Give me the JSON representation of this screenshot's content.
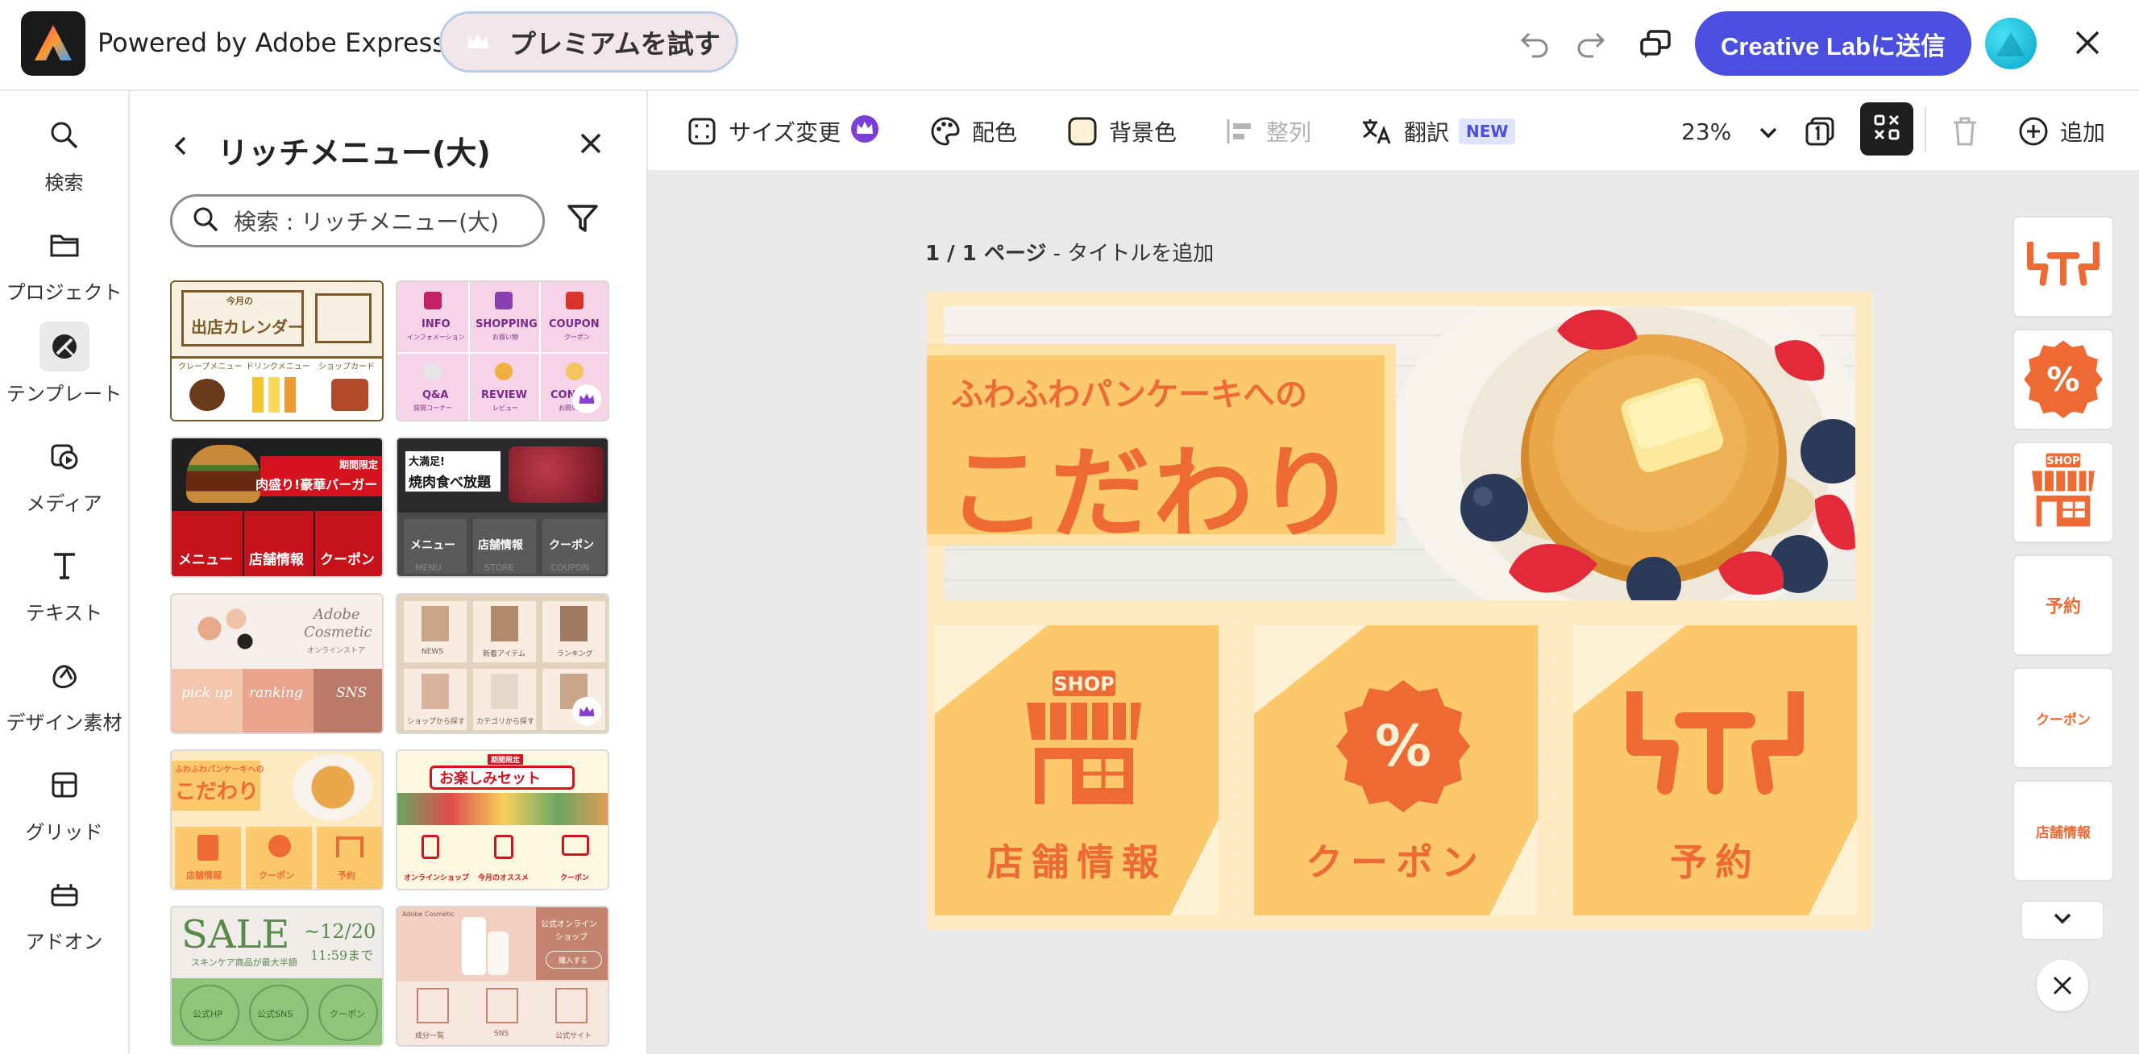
{
  "header": {
    "brand": "Powered by Adobe Express",
    "premium_label": "プレミアムを試す",
    "send_label": "Creative Labに送信",
    "icons": [
      "adobe-express-logo",
      "undo-icon",
      "redo-icon",
      "share-icon",
      "avatar",
      "close-icon"
    ]
  },
  "rail": {
    "items": [
      {
        "label": "検索",
        "icon": "search-icon"
      },
      {
        "label": "プロジェクト",
        "icon": "folder-icon"
      },
      {
        "label": "テンプレート",
        "icon": "template-icon"
      },
      {
        "label": "メディア",
        "icon": "media-icon"
      },
      {
        "label": "テキスト",
        "icon": "text-icon"
      },
      {
        "label": "デザイン素材",
        "icon": "shapes-icon"
      },
      {
        "label": "グリッド",
        "icon": "grid-icon"
      },
      {
        "label": "アドオン",
        "icon": "addon-icon"
      }
    ]
  },
  "panel": {
    "title": "リッチメニュー(大)",
    "search_value": "検索 : リッチメニュー(大)",
    "thumbnails": [
      {
        "texts": [
          "今月の",
          "出店カレンダー",
          "クレープメニュー",
          "ドリンクメニュー",
          "ショップカード"
        ]
      },
      {
        "texts": [
          "INFO",
          "SHOPPING",
          "COUPON",
          "インフォメーション",
          "お買い物",
          "クーポン",
          "Q&A",
          "REVIEW",
          "CON",
          "質問コーナー",
          "レビュー",
          "お問い"
        ]
      },
      {
        "texts": [
          "期間限定",
          "肉盛り!豪華バーガー",
          "メニュー",
          "店舗情報",
          "クーポン"
        ]
      },
      {
        "texts": [
          "大満足!",
          "焼肉食べ放題",
          "メニュー",
          "店舗情報",
          "クーポン",
          "MENU",
          "STORE",
          "COUPON"
        ]
      },
      {
        "texts": [
          "Adobe",
          "Cosmetic",
          "オンラインストア",
          "pick up",
          "ranking",
          "SNS"
        ]
      },
      {
        "texts": [
          "NEWS",
          "新着アイテム",
          "ランキング",
          "ショップから探す",
          "カテゴリから探す"
        ]
      },
      {
        "texts": [
          "ふわふわパンケーキへの",
          "こだわり",
          "店舗情報",
          "クーポン",
          "予約"
        ]
      },
      {
        "texts": [
          "期間限定",
          "お楽しみセット",
          "オンラインショップ",
          "今月のオススメ",
          "クーポン"
        ]
      },
      {
        "texts": [
          "SALE",
          "~12/20",
          "11:59まで",
          "スキンケア商品が最大半額",
          "公式HP",
          "公式SNS",
          "クーポン"
        ]
      },
      {
        "texts": [
          "Adobe Cosmetic",
          "公式オンライン",
          "ショップ",
          "購入する",
          "成分一覧",
          "SNS",
          "公式サイト"
        ]
      }
    ]
  },
  "toolbar": {
    "resize": "サイズ変更",
    "color": "配色",
    "background": "背景色",
    "align": "整列",
    "translate": "翻訳",
    "new_badge": "NEW",
    "zoom": "23%",
    "add": "追加"
  },
  "canvas": {
    "page_number": "1 / 1 ページ",
    "page_title_prompt": " - タイトルを追加",
    "subtitle": "ふわふわパンケーキへの",
    "title": "こだわり",
    "shop_sign": "SHOP",
    "cards": [
      "店舗情報",
      "クーポン",
      "予約"
    ],
    "percent": "%"
  },
  "quick_panel": {
    "items": [
      "予約",
      "クーポン",
      "店舗情報"
    ],
    "shop_sign": "SHOP"
  },
  "colors": {
    "accent": "#4b4fe0",
    "design_orange": "#ee6a35",
    "design_yellow": "#fbc86c",
    "design_cream": "#fde9c2"
  }
}
